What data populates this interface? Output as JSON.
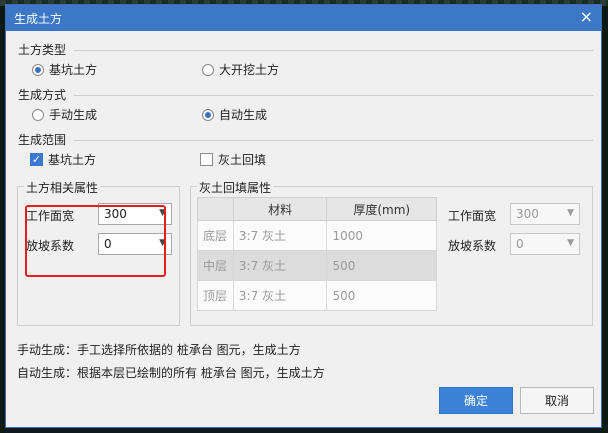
{
  "window": {
    "title": "生成土方",
    "close_glyph": "×"
  },
  "earthwork_type": {
    "label": "土方类型",
    "options": [
      {
        "label": "基坑土方",
        "selected": true
      },
      {
        "label": "大开挖土方",
        "selected": false
      }
    ]
  },
  "generation_mode": {
    "label": "生成方式",
    "options": [
      {
        "label": "手动生成",
        "selected": false
      },
      {
        "label": "自动生成",
        "selected": true
      }
    ]
  },
  "generation_scope": {
    "label": "生成范围",
    "options": [
      {
        "label": "基坑土方",
        "checked": true
      },
      {
        "label": "灰土回填",
        "checked": false
      }
    ]
  },
  "earthwork_props": {
    "title": "土方相关属性",
    "work_width": {
      "label": "工作面宽",
      "value": "300"
    },
    "slope_coef": {
      "label": "放坡系数",
      "value": "0"
    }
  },
  "backfill_props": {
    "title": "灰土回填属性",
    "table": {
      "headers": [
        "",
        "材料",
        "厚度(mm)"
      ],
      "rows": [
        {
          "layer": "底层",
          "material": "3:7 灰土",
          "thickness": "1000"
        },
        {
          "layer": "中层",
          "material": "3:7 灰土",
          "thickness": "500"
        },
        {
          "layer": "顶层",
          "material": "3:7 灰土",
          "thickness": "500"
        }
      ]
    },
    "work_width": {
      "label": "工作面宽",
      "value": "300"
    },
    "slope_coef": {
      "label": "放坡系数",
      "value": "0"
    }
  },
  "notes": {
    "manual": "手动生成：手工选择所依据的 桩承台 图元，生成土方",
    "auto": "自动生成：根据本层已绘制的所有 桩承台 图元，生成土方"
  },
  "buttons": {
    "ok": "确定",
    "cancel": "取消"
  },
  "colors": {
    "title_bar": "#3c78c6",
    "accent": "#3c82d8",
    "highlight": "#e02020"
  }
}
